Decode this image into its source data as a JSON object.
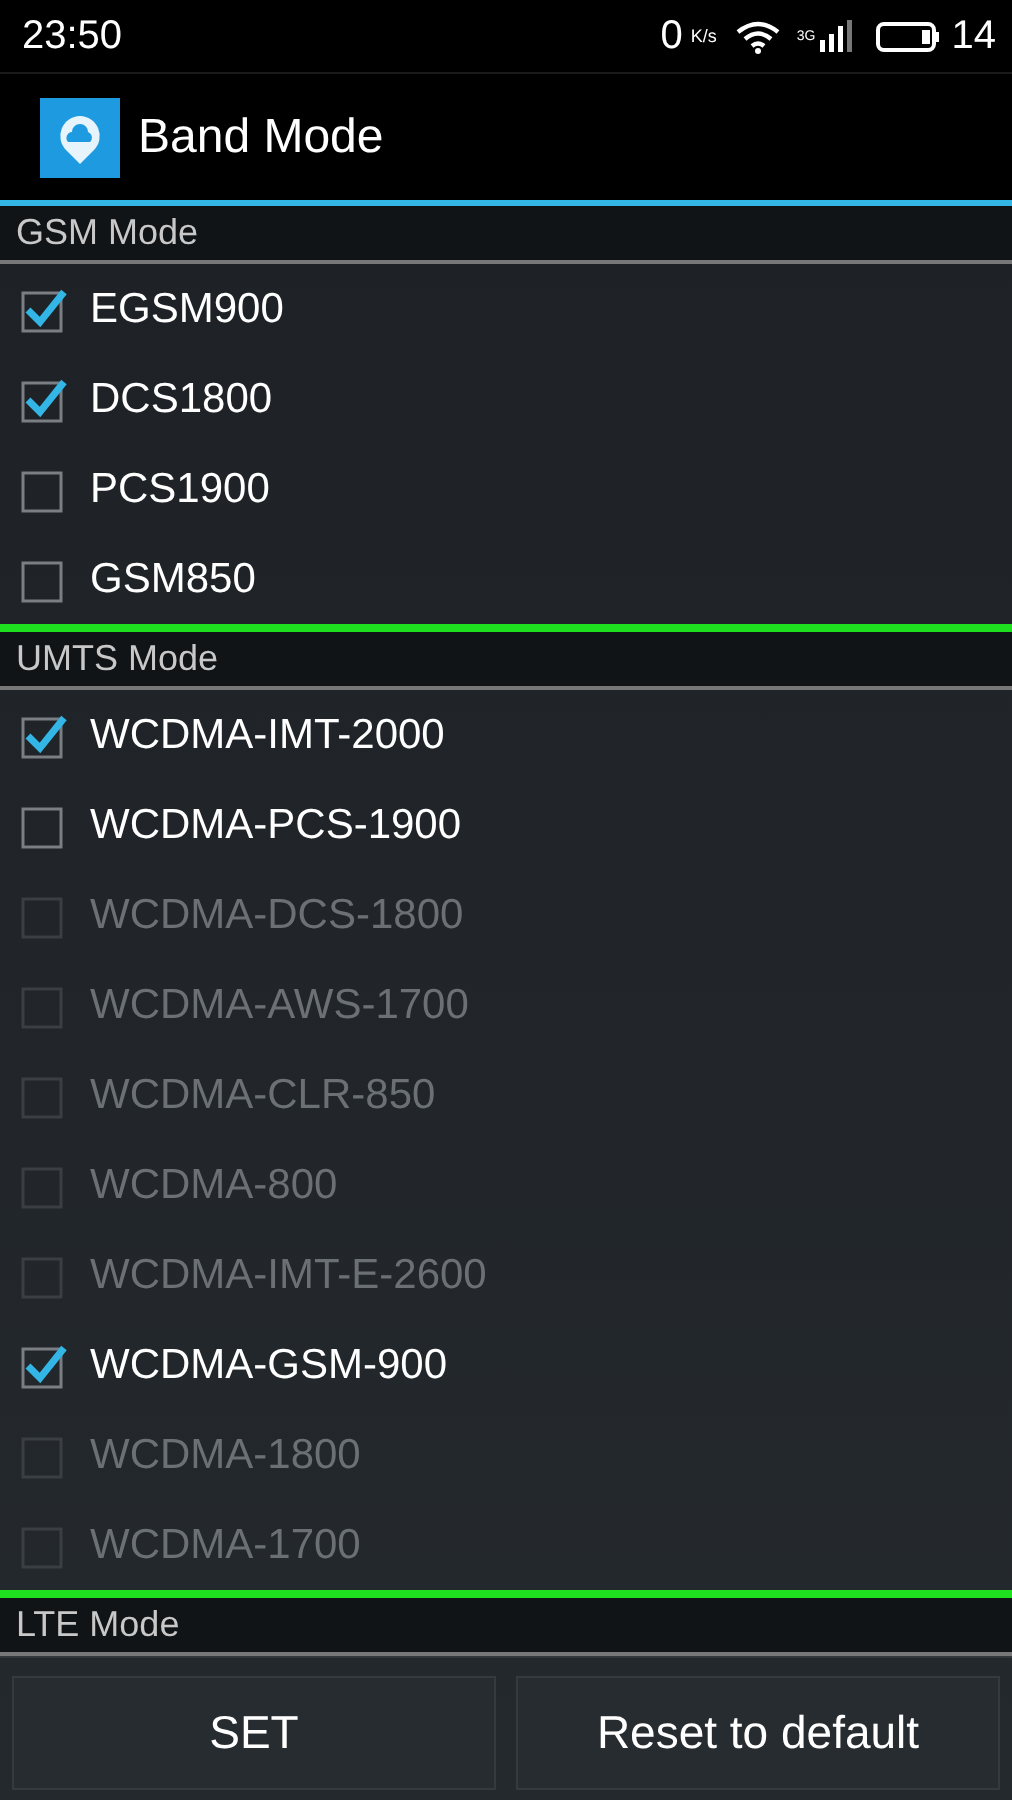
{
  "status_bar": {
    "time": "23:50",
    "speed": "0",
    "speed_unit": "K/s",
    "network": "3G",
    "battery": "14"
  },
  "app_bar": {
    "title": "Band Mode"
  },
  "sections": [
    {
      "title": "GSM Mode",
      "items": [
        {
          "label": "EGSM900",
          "checked": true,
          "disabled": false
        },
        {
          "label": "DCS1800",
          "checked": true,
          "disabled": false
        },
        {
          "label": "PCS1900",
          "checked": false,
          "disabled": false
        },
        {
          "label": "GSM850",
          "checked": false,
          "disabled": false
        }
      ]
    },
    {
      "title": "UMTS Mode",
      "items": [
        {
          "label": "WCDMA-IMT-2000",
          "checked": true,
          "disabled": false
        },
        {
          "label": "WCDMA-PCS-1900",
          "checked": false,
          "disabled": false
        },
        {
          "label": "WCDMA-DCS-1800",
          "checked": false,
          "disabled": true
        },
        {
          "label": "WCDMA-AWS-1700",
          "checked": false,
          "disabled": true
        },
        {
          "label": "WCDMA-CLR-850",
          "checked": false,
          "disabled": true
        },
        {
          "label": "WCDMA-800",
          "checked": false,
          "disabled": true
        },
        {
          "label": "WCDMA-IMT-E-2600",
          "checked": false,
          "disabled": true
        },
        {
          "label": "WCDMA-GSM-900",
          "checked": true,
          "disabled": false
        },
        {
          "label": "WCDMA-1800",
          "checked": false,
          "disabled": true
        },
        {
          "label": "WCDMA-1700",
          "checked": false,
          "disabled": true
        }
      ]
    },
    {
      "title": "LTE Mode"
    }
  ],
  "buttons": [
    "SET",
    "Reset to default"
  ]
}
